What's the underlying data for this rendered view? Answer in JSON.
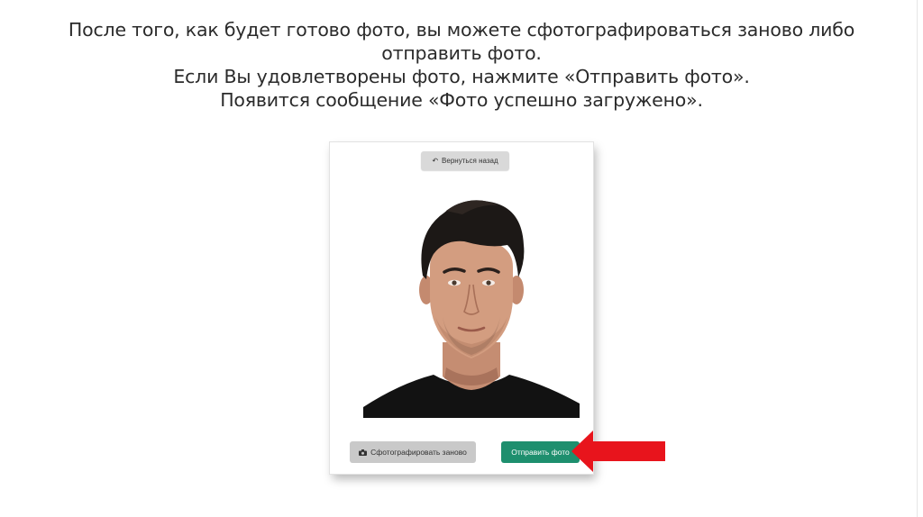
{
  "instructions": {
    "line1": "После того, как будет готово фото, вы можете сфотографироваться заново либо",
    "line2": "отправить фото.",
    "line3": "Если Вы удовлетворены фото, нажмите «Отправить фото».",
    "line4": "Появится сообщение «Фото успешно загружено»."
  },
  "screen": {
    "back_button_label": "Вернуться назад",
    "back_icon": "back-arrow-icon",
    "retake_button_label": "Сфотографировать заново",
    "retake_icon": "camera-icon",
    "send_button_label": "Отправить фото"
  },
  "colors": {
    "send_button": "#1e8f6e",
    "secondary_button": "#d9d9d9",
    "pointer_arrow": "#e8141c",
    "text": "#2b2b2b"
  }
}
